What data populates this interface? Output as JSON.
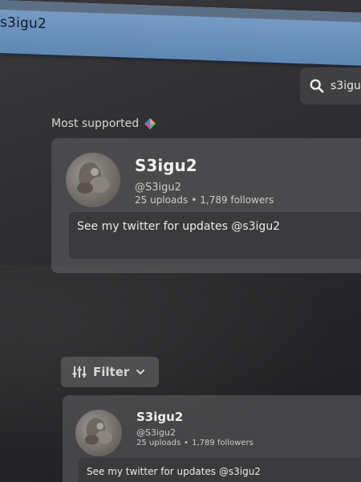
{
  "browser": {
    "tab_title": "s3igu2"
  },
  "search": {
    "value": "s3igu",
    "icon": "search-icon"
  },
  "most_supported": {
    "label": "Most supported",
    "icon": "support-badge-icon",
    "card": {
      "display_name": "S3igu2",
      "handle": "@S3igu2",
      "uploads": "25 uploads",
      "followers": "1,789 followers",
      "bio": "See my twitter for updates @s3igu2"
    }
  },
  "filter": {
    "label": "Filter",
    "icon": "sliders-icon"
  },
  "results": [
    {
      "display_name": "S3igu2",
      "handle": "@S3igu2",
      "uploads": "25 uploads",
      "followers": "1,789 followers",
      "bio": "See my twitter for updates @s3igu2"
    }
  ],
  "colors": {
    "browser_bar": "#5f87b3",
    "page_bg": "#2b2a2c",
    "card_bg": "#4a494b"
  }
}
